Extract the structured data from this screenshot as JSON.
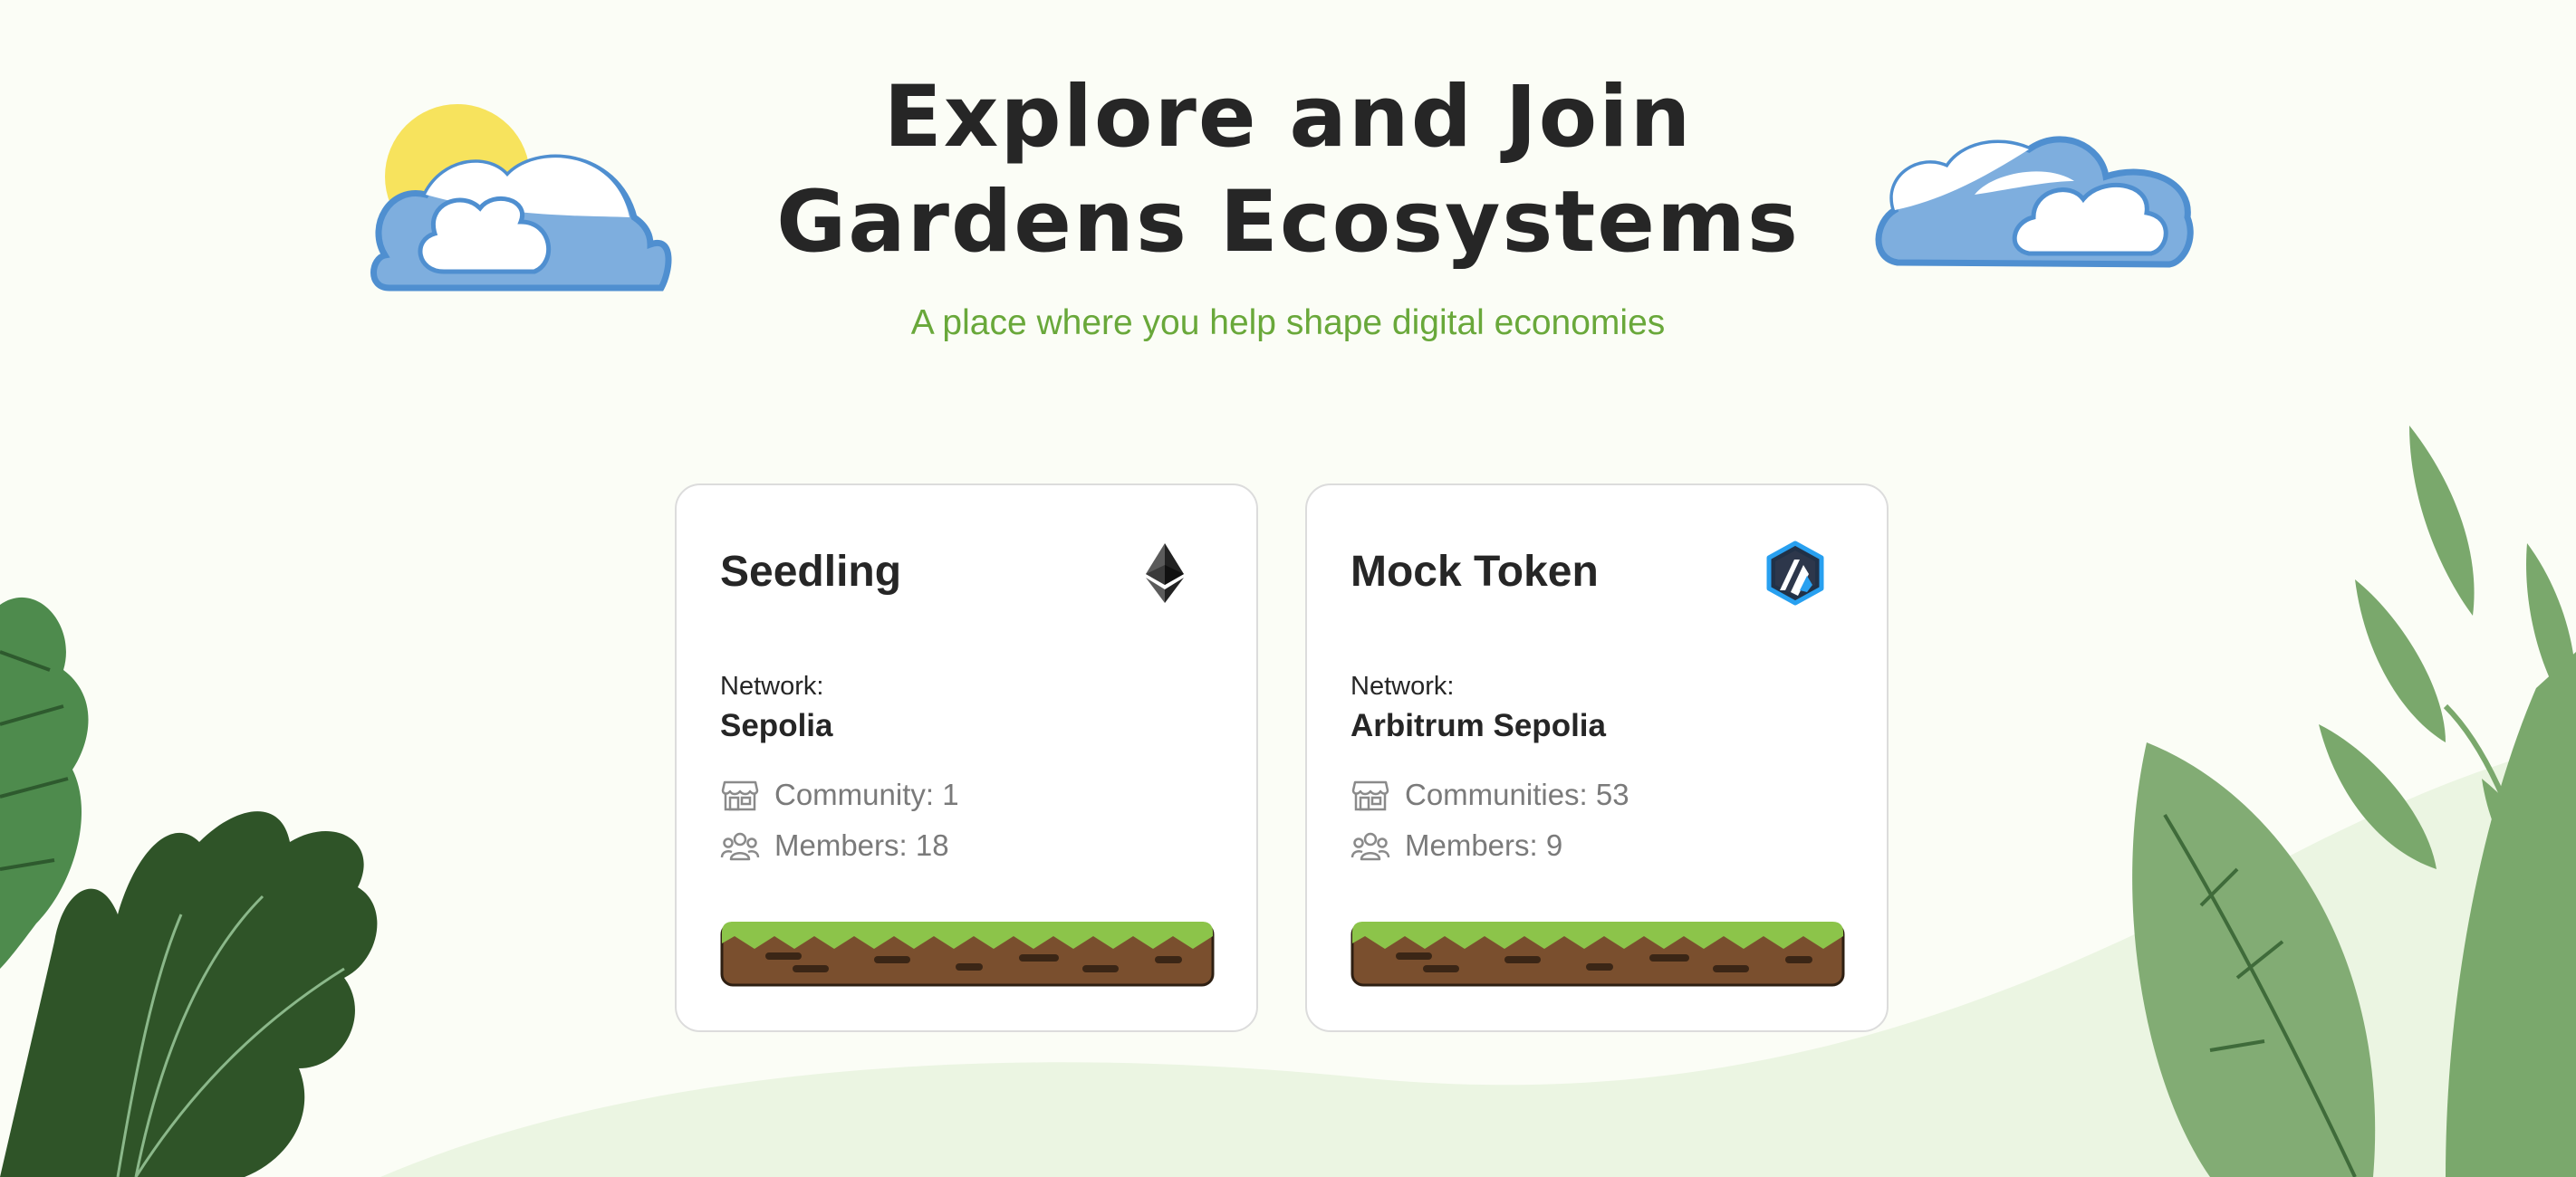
{
  "header": {
    "title_line1": "Explore and Join",
    "title_line2": "Gardens Ecosystems",
    "subtitle": "A place where you help shape digital economies"
  },
  "cards": [
    {
      "title": "Seedling",
      "chain_icon": "ethereum-icon",
      "network_label": "Network:",
      "network": "Sepolia",
      "communities": "Community: 1",
      "members": "Members: 18"
    },
    {
      "title": "Mock Token",
      "chain_icon": "arbitrum-icon",
      "network_label": "Network:",
      "network": "Arbitrum Sepolia",
      "communities": "Communities: 53",
      "members": "Members: 9"
    }
  ],
  "colors": {
    "background": "#fbfdf6",
    "subtitle": "#69a83a",
    "title": "#262626",
    "card_border": "#dcdcdc",
    "stat_text": "#7a7a7a"
  }
}
